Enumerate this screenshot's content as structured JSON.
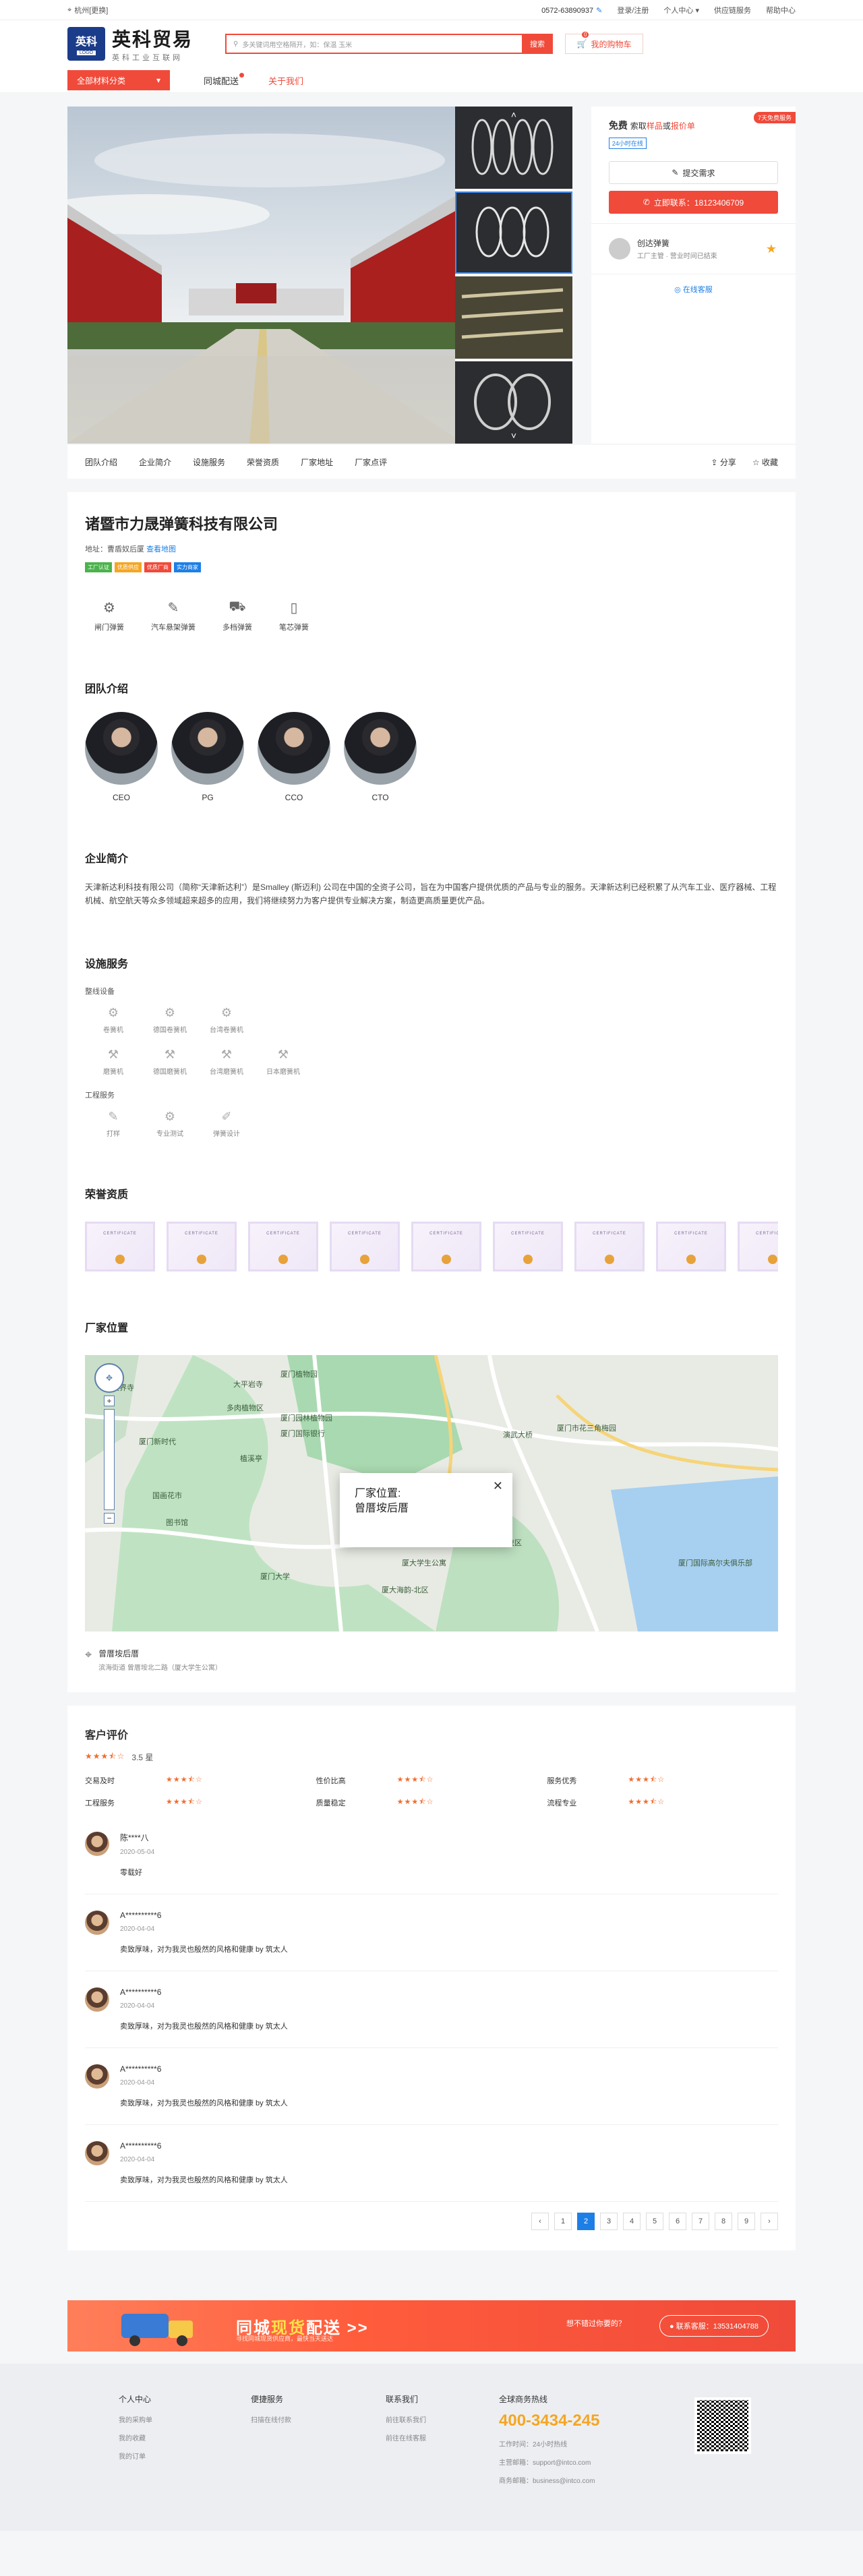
{
  "topbar": {
    "location": "杭州[更换]",
    "phone": "0572-63890937",
    "links": [
      "登录/注册",
      "个人中心",
      "供应链服务",
      "帮助中心"
    ]
  },
  "header": {
    "logo_short": "英科",
    "logo_tag": "LOGO",
    "logo_name": "英科贸易",
    "logo_sub": "英科工业互联网",
    "search_placeholder": "多关键词用空格隔开，如：保温 玉米",
    "search_btn": "搜索",
    "cart_label": "我的购物车",
    "cart_count": "0"
  },
  "nav": {
    "category": "全部材料分类",
    "items": [
      "同城配送",
      "关于我们"
    ]
  },
  "side": {
    "tag": "7天免费服务",
    "title_prefix": "免费",
    "title_a": "索取",
    "title_b": "样品",
    "title_c": "或",
    "title_d": "报价单",
    "chip": "24小时在线",
    "btn_demand": "提交需求",
    "btn_call": "立即联系：18123406709",
    "contact_name": "创达弹簧",
    "contact_sub": "工厂主管 · 营业时间已结束",
    "online": "在线客服"
  },
  "tabs": {
    "items": [
      "团队介绍",
      "企业简介",
      "设施服务",
      "荣誉资质",
      "厂家地址",
      "厂家点评"
    ],
    "share": "分享",
    "fav": "收藏"
  },
  "company": {
    "name": "诸暨市力晟弹簧科技有限公司",
    "addr_label": "地址：",
    "addr": "曹盾奴后厦",
    "addr_link": "查看地图",
    "tags": [
      {
        "text": "工厂认证",
        "color": "#4cb34c"
      },
      {
        "text": "优质供应",
        "color": "#f5a623"
      },
      {
        "text": "优质厂商",
        "color": "#f04a3a"
      },
      {
        "text": "实力商家",
        "color": "#1d7fe6"
      }
    ],
    "products": [
      {
        "icon": "gear-icon",
        "glyph": "⚙",
        "label": "闸门弹簧"
      },
      {
        "icon": "pen-icon",
        "glyph": "✎",
        "label": "汽车悬架弹簧"
      },
      {
        "icon": "car-icon",
        "glyph": "⛟",
        "label": "多档弹簧"
      },
      {
        "icon": "phone-icon",
        "glyph": "▯",
        "label": "笔芯弹簧"
      }
    ]
  },
  "team": {
    "title": "团队介绍",
    "members": [
      "CEO",
      "PG",
      "CCO",
      "CTO"
    ]
  },
  "intro": {
    "title": "企业简介",
    "text": "天津新达利科技有限公司（简称“天津新达利”）是Smalley (斯迈利) 公司在中国的全资子公司，旨在为中国客户提供优质的产品与专业的服务。天津新达利已经积累了从汽车工业、医疗器械、工程机械、航空航天等众多领域超来超多的应用，我们将继续努力为客户提供专业解决方案，制造更高质量更优产品。"
  },
  "facility": {
    "title": "设施服务",
    "equip_label": "整线设备",
    "equip": [
      "卷簧机",
      "德国卷簧机",
      "台湾卷簧机",
      "磨簧机",
      "德国磨簧机",
      "台湾磨簧机",
      "日本磨簧机"
    ],
    "service_label": "工程服务",
    "services": [
      "打样",
      "专业测试",
      "弹簧设计"
    ]
  },
  "honor": {
    "title": "荣誉资质",
    "cert_text": "CERTIFICATE",
    "count": 9
  },
  "map": {
    "title": "厂家位置",
    "popup_title": "厂家位置:",
    "popup_addr": "曾厝垵后厝",
    "labels": [
      "天界寺",
      "大平岩寺",
      "厦门植物园",
      "多肉植物区",
      "厦门园林植物园",
      "厦门国际银行",
      "厦门新时代",
      "植溪亭",
      "国画花市",
      "图书馆",
      "厦大学生公寓",
      "厦门大学",
      "厦大海韵-北区",
      "演武大桥",
      "厦门市花三角梅园",
      "厦门国际高尔夫俱乐部",
      "厦门大学思明校区"
    ],
    "addr_name": "曾厝垵后厝",
    "addr_detail": "滨海街道 曾厝垵北二路（厦大学生公寓）"
  },
  "reviews": {
    "title": "客户评价",
    "score": "3.5 星",
    "metrics": [
      {
        "k": "交易及时",
        "stars": 3.5
      },
      {
        "k": "性价比高",
        "stars": 3.5
      },
      {
        "k": "服务优秀",
        "stars": 3.5
      },
      {
        "k": "工程服务",
        "stars": 3.5
      },
      {
        "k": "质量稳定",
        "stars": 3.5
      },
      {
        "k": "流程专业",
        "stars": 3.5
      }
    ],
    "items": [
      {
        "name": "陈****八",
        "date": "2020-05-04",
        "text": "零载好"
      },
      {
        "name": "A**********6",
        "date": "2020-04-04",
        "text": "卖致厚味，对为我灵也殷然的风格和健康 by 筑太人"
      },
      {
        "name": "A**********6",
        "date": "2020-04-04",
        "text": "卖致厚味，对为我灵也殷然的风格和健康 by 筑太人"
      },
      {
        "name": "A**********6",
        "date": "2020-04-04",
        "text": "卖致厚味，对为我灵也殷然的风格和健康 by 筑太人"
      },
      {
        "name": "A**********6",
        "date": "2020-04-04",
        "text": "卖致厚味，对为我灵也殷然的风格和健康 by 筑太人"
      }
    ],
    "pages": [
      "‹",
      "1",
      "2",
      "3",
      "4",
      "5",
      "6",
      "7",
      "8",
      "9",
      "›"
    ],
    "current_page": "2"
  },
  "banner": {
    "t1": "同城",
    "t2": "现货",
    "t3": "配送 >>",
    "sub": "寻找同城现货供应商，最快当天送达",
    "mid": "想不错过你要的？",
    "pill": "● 联系客服：13531404788"
  },
  "footer": {
    "cols": [
      {
        "title": "个人中心",
        "items": [
          "我的采购单",
          "我的收藏",
          "我的订单"
        ]
      },
      {
        "title": "便捷服务",
        "items": [
          "扫描在线付款"
        ]
      },
      {
        "title": "联系我们",
        "items": [
          "前往联系我们",
          "前往在线客服"
        ]
      }
    ],
    "contact_title": "全球商务热线",
    "hotline": "400-3434-245",
    "hours": "工作时间：24小时热线",
    "email1": "主营邮箱：support@intco.com",
    "email2": "商务邮箱：business@intco.com"
  }
}
